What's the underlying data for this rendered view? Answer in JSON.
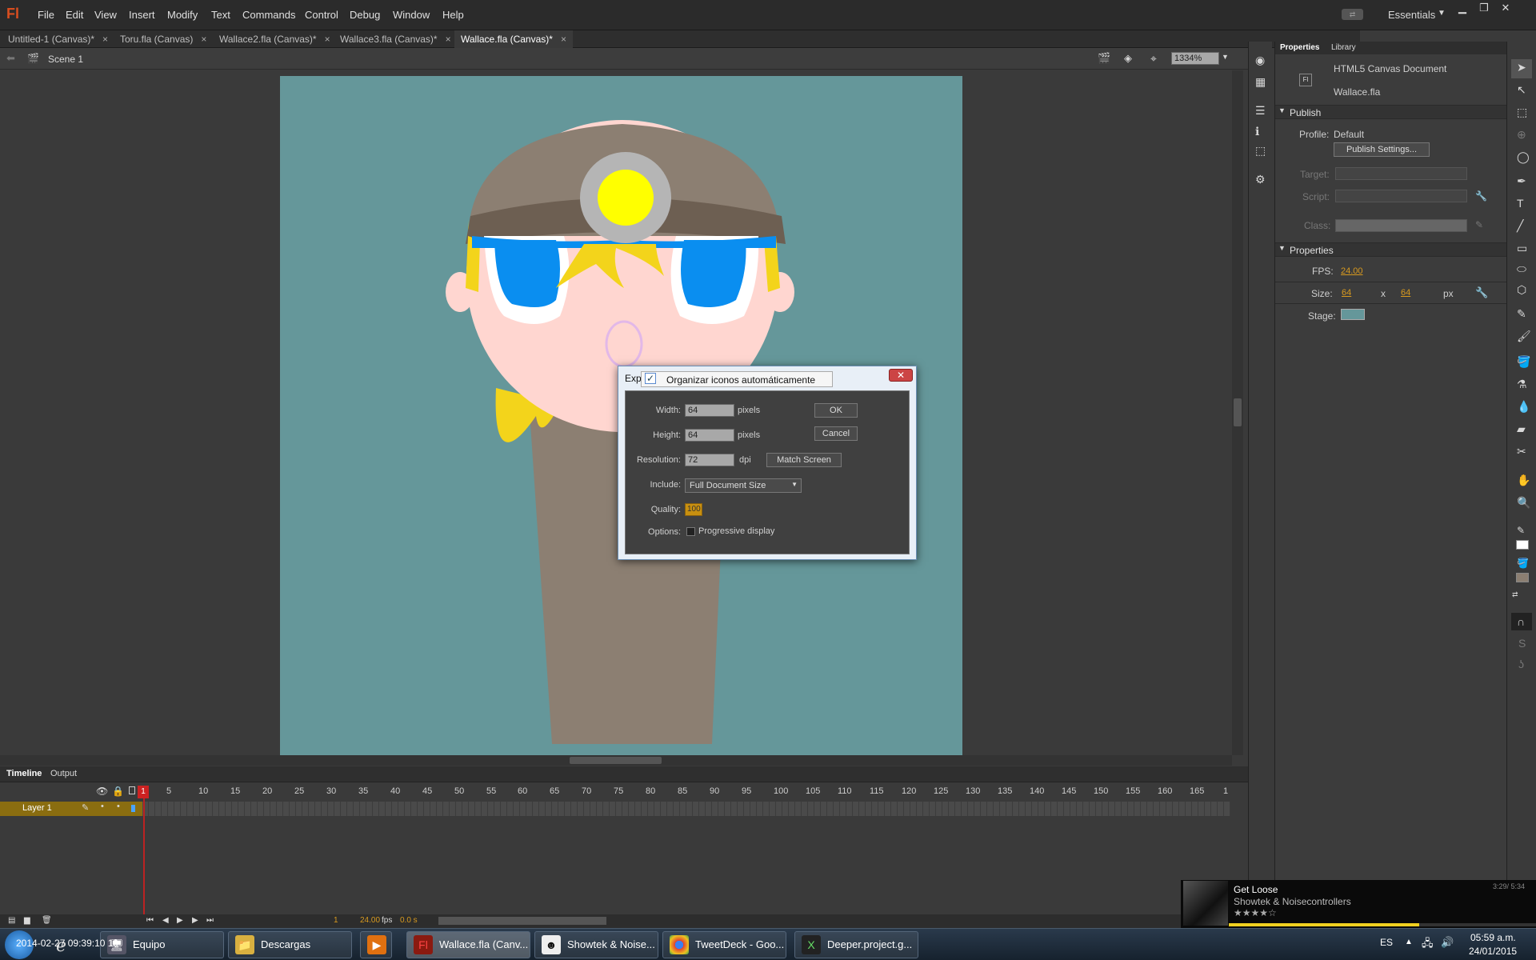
{
  "app": {
    "logo": "Fl",
    "workspace": "Essentials"
  },
  "menu": [
    "File",
    "Edit",
    "View",
    "Insert",
    "Modify",
    "Text",
    "Commands",
    "Control",
    "Debug",
    "Window",
    "Help"
  ],
  "tabs": [
    "Untitled-1 (Canvas)*",
    "Toru.fla (Canvas)",
    "Wallace2.fla (Canvas)*",
    "Wallace3.fla (Canvas)*",
    "Wallace.fla (Canvas)*"
  ],
  "scene": {
    "name": "Scene 1",
    "zoom": "1334%"
  },
  "stage_color": "#65979a",
  "timeline": {
    "tabs": [
      "Timeline",
      "Output"
    ],
    "layer": "Layer 1",
    "ticks": [
      "1",
      "5",
      "10",
      "15",
      "20",
      "25",
      "30",
      "35",
      "40",
      "45",
      "50",
      "55",
      "60",
      "65",
      "70",
      "75",
      "80",
      "85",
      "90",
      "95",
      "100",
      "105",
      "110",
      "115",
      "120",
      "125",
      "130",
      "135",
      "140",
      "145",
      "150",
      "155",
      "160",
      "165",
      "1"
    ],
    "current_frame": "1",
    "fps": "24.00",
    "fps_unit": "fps",
    "time": "0.0 s"
  },
  "properties": {
    "tabs": [
      "Properties",
      "Library"
    ],
    "doc_type": "HTML5 Canvas Document",
    "doc_icon": "Fl",
    "file": "Wallace.fla",
    "publish_head": "Publish",
    "profile_label": "Profile:",
    "profile_value": "Default",
    "publish_settings": "Publish Settings...",
    "target_label": "Target:",
    "script_label": "Script:",
    "class_label": "Class:",
    "props_head": "Properties",
    "fps_label": "FPS:",
    "fps": "24.00",
    "size_label": "Size:",
    "width": "64",
    "x": "x",
    "height": "64",
    "unit": "px",
    "stage_label": "Stage:",
    "stage_swatch": "#65979a"
  },
  "dialog": {
    "title": "Exp",
    "tooltip": "Organizar iconos automáticamente",
    "width_label": "Width:",
    "width": "64",
    "width_unit": "pixels",
    "height_label": "Height:",
    "height": "64",
    "height_unit": "pixels",
    "res_label": "Resolution:",
    "res": "72",
    "res_unit": "dpi",
    "match": "Match Screen",
    "include_label": "Include:",
    "include": "Full Document Size",
    "quality_label": "Quality:",
    "quality": "100",
    "options_label": "Options:",
    "progressive": "Progressive display",
    "ok": "OK",
    "cancel": "Cancel"
  },
  "taskbar": {
    "items": [
      {
        "label": "Equipo",
        "icon": "computer-icon"
      },
      {
        "label": "Descargas",
        "icon": "folder-icon"
      },
      {
        "label": "",
        "icon": "media-player-icon"
      },
      {
        "label": "Wallace.fla (Canv...",
        "icon": "flash-icon"
      },
      {
        "label": "Showtek & Noise...",
        "icon": "music-app-icon"
      },
      {
        "label": "TweetDeck - Goo...",
        "icon": "chrome-icon"
      },
      {
        "label": "Deeper.project.g...",
        "icon": "xna-icon"
      }
    ],
    "overlay_text": "2014-02-27 09:39:10 19",
    "lang": "ES",
    "time": "05:59 a.m.",
    "date": "24/01/2015"
  },
  "media": {
    "title": "Get Loose",
    "artist": "Showtek & Noisecontrollers",
    "time": "3:29/ 5:34",
    "rating_stars": 4
  }
}
